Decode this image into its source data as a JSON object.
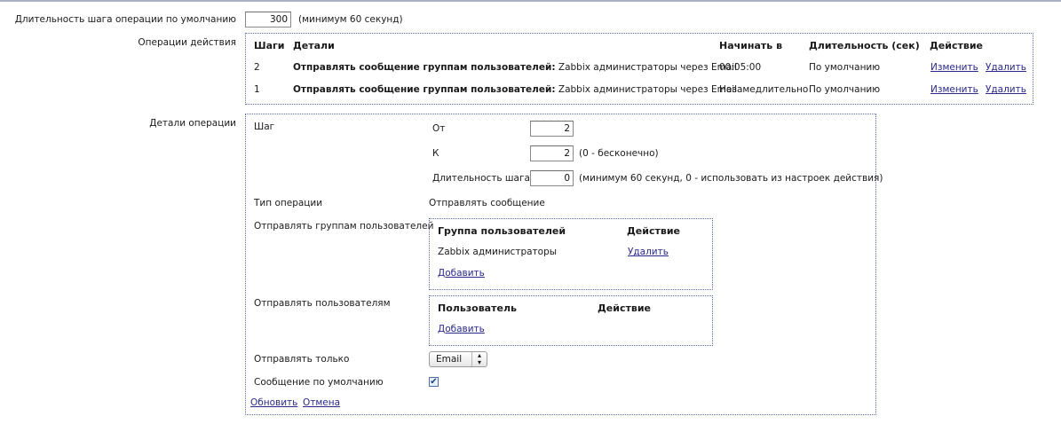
{
  "top": {
    "step_duration_label": "Длительность шага операции по умолчанию",
    "step_duration_value": "300",
    "step_duration_hint": "(минимум 60 секунд)"
  },
  "operations": {
    "label": "Операции действия",
    "headers": {
      "steps": "Шаги",
      "details": "Детали",
      "start_in": "Начинать в",
      "duration": "Длительность (сек)",
      "action": "Действие"
    },
    "rows": [
      {
        "step": "2",
        "details_bold": "Отправлять сообщение группам пользователей:",
        "details_rest": "Zabbix администраторы через Email",
        "start_in": "00:05:00",
        "duration": "По умолчанию",
        "edit": "Изменить",
        "delete": "Удалить"
      },
      {
        "step": "1",
        "details_bold": "Отправлять сообщение группам пользователей:",
        "details_rest": "Zabbix администраторы через Email",
        "start_in": "Незамедлительно",
        "duration": "По умолчанию",
        "edit": "Изменить",
        "delete": "Удалить"
      }
    ]
  },
  "details": {
    "label": "Детали операции",
    "step_label": "Шаг",
    "from_label": "От",
    "from_value": "2",
    "to_label": "К",
    "to_value": "2",
    "to_hint": "(0 - бесконечно)",
    "duration_label": "Длительность шага",
    "duration_value": "0",
    "duration_hint": "(минимум 60 секунд, 0 - использовать из настроек действия)",
    "op_type_label": "Тип операции",
    "op_type_value": "Отправлять сообщение",
    "send_groups_label": "Отправлять группам пользователей",
    "groups_table": {
      "col_group": "Группа пользователей",
      "col_action": "Действие",
      "row_group": "Zabbix администраторы",
      "row_delete": "Удалить",
      "add": "Добавить"
    },
    "send_users_label": "Отправлять пользователям",
    "users_table": {
      "col_user": "Пользователь",
      "col_action": "Действие",
      "add": "Добавить"
    },
    "send_only_label": "Отправлять только",
    "send_only_value": "Email",
    "default_msg_label": "Сообщение по умолчанию",
    "default_msg_checked": true,
    "update": "Обновить",
    "cancel": "Отмена"
  }
}
